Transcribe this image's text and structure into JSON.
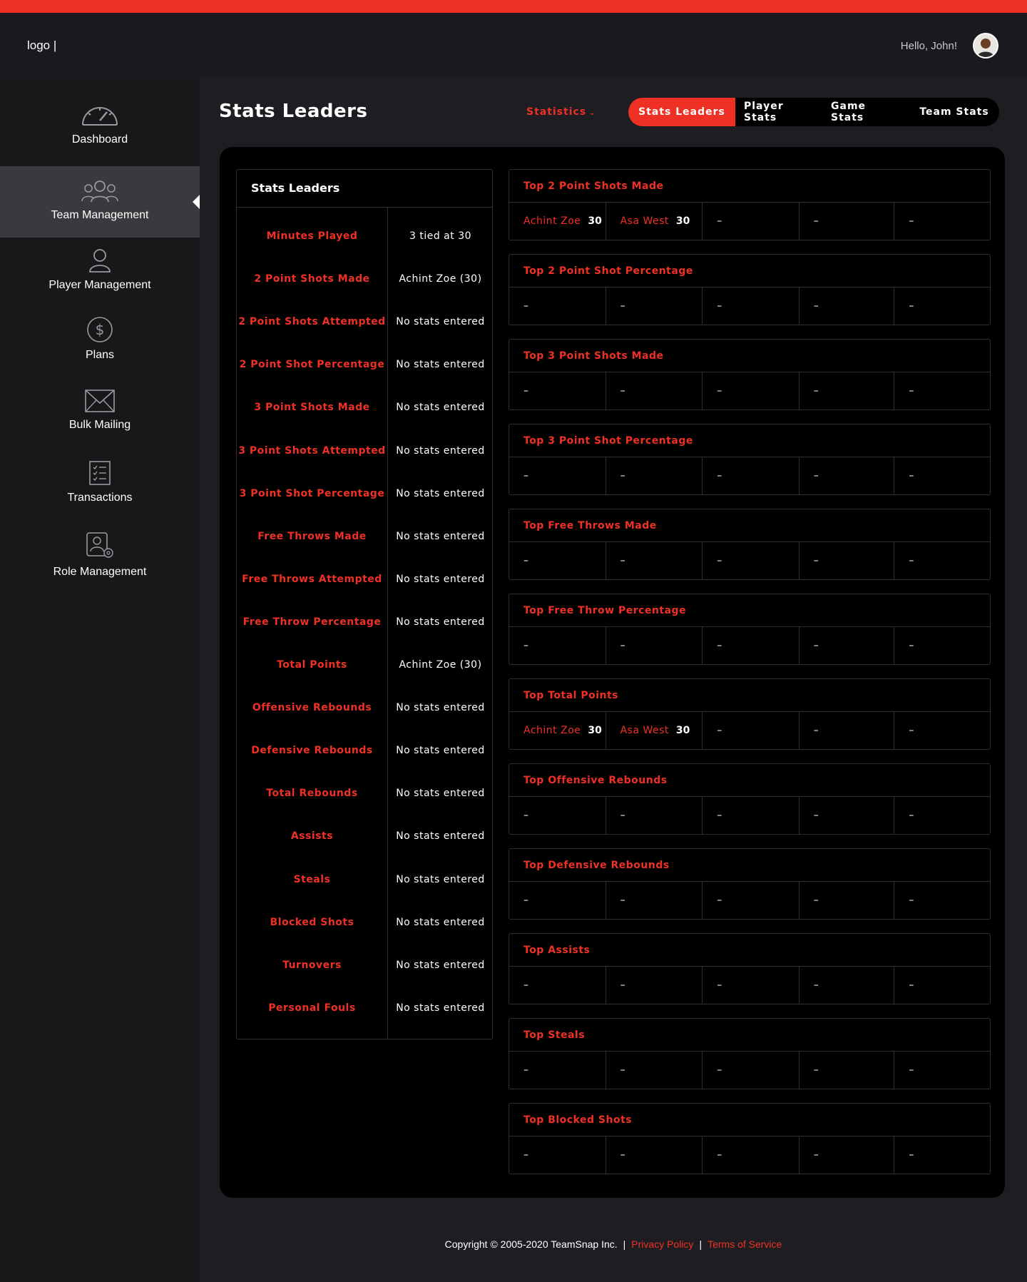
{
  "header": {
    "logo": "logo |",
    "greeting": "Hello, John!"
  },
  "colors": {
    "accent": "#ef3125",
    "panel": "#000000",
    "sidebar": "#18181b"
  },
  "sidebar": {
    "items": [
      {
        "label": "Dashboard",
        "icon": "dashboard-icon"
      },
      {
        "label": "Team Management",
        "icon": "team-icon",
        "active": true
      },
      {
        "label": "Player Management",
        "icon": "player-icon"
      },
      {
        "label": "Plans",
        "icon": "dollar-icon"
      },
      {
        "label": "Bulk Mailing",
        "icon": "envelope-icon"
      },
      {
        "label": "Transactions",
        "icon": "checklist-icon"
      },
      {
        "label": "Role Management",
        "icon": "role-settings-icon"
      }
    ]
  },
  "page": {
    "title": "Stats Leaders",
    "dropdown_label": "Statistics",
    "tabs": [
      "Stats Leaders",
      "Player Stats",
      "Game Stats",
      "Team Stats"
    ]
  },
  "leaders": {
    "title": "Stats Leaders",
    "rows": [
      {
        "name": "Minutes Played",
        "value": "3 tied at 30"
      },
      {
        "name": "2 Point Shots Made",
        "value": "Achint Zoe (30)"
      },
      {
        "name": "2 Point Shots Attempted",
        "value": "No stats entered"
      },
      {
        "name": "2 Point Shot Percentage",
        "value": "No stats entered"
      },
      {
        "name": "3 Point Shots Made",
        "value": "No stats entered"
      },
      {
        "name": "3 Point Shots Attempted",
        "value": "No stats entered"
      },
      {
        "name": "3 Point Shot Percentage",
        "value": "No stats entered"
      },
      {
        "name": "Free Throws Made",
        "value": "No stats entered"
      },
      {
        "name": "Free Throws Attempted",
        "value": "No stats entered"
      },
      {
        "name": "Free Throw Percentage",
        "value": "No stats entered"
      },
      {
        "name": "Total Points",
        "value": "Achint Zoe (30)"
      },
      {
        "name": "Offensive Rebounds",
        "value": "No stats entered"
      },
      {
        "name": "Defensive Rebounds",
        "value": "No stats entered"
      },
      {
        "name": "Total Rebounds",
        "value": "No stats entered"
      },
      {
        "name": "Assists",
        "value": "No stats entered"
      },
      {
        "name": "Steals",
        "value": "No stats entered"
      },
      {
        "name": "Blocked Shots",
        "value": "No stats entered"
      },
      {
        "name": "Turnovers",
        "value": "No stats entered"
      },
      {
        "name": "Personal Fouls",
        "value": "No stats entered"
      }
    ]
  },
  "cards": [
    {
      "title": "Top 2 Point Shots Made",
      "cells": [
        {
          "name": "Achint Zoe",
          "value": "30"
        },
        {
          "name": "Asa West",
          "value": "30"
        },
        {
          "value": "–"
        },
        {
          "value": "–"
        },
        {
          "value": "–"
        }
      ]
    },
    {
      "title": "Top 2 Point Shot Percentage",
      "cells": [
        {
          "value": "–"
        },
        {
          "value": "–"
        },
        {
          "value": "–"
        },
        {
          "value": "–"
        },
        {
          "value": "–"
        }
      ]
    },
    {
      "title": "Top 3 Point Shots Made",
      "cells": [
        {
          "value": "–"
        },
        {
          "value": "–"
        },
        {
          "value": "–"
        },
        {
          "value": "–"
        },
        {
          "value": "–"
        }
      ]
    },
    {
      "title": "Top 3 Point Shot Percentage",
      "cells": [
        {
          "value": "–"
        },
        {
          "value": "–"
        },
        {
          "value": "–"
        },
        {
          "value": "–"
        },
        {
          "value": "–"
        }
      ]
    },
    {
      "title": "Top Free Throws Made",
      "cells": [
        {
          "value": "–"
        },
        {
          "value": "–"
        },
        {
          "value": "–"
        },
        {
          "value": "–"
        },
        {
          "value": "–"
        }
      ]
    },
    {
      "title": "Top Free Throw Percentage",
      "cells": [
        {
          "value": "–"
        },
        {
          "value": "–"
        },
        {
          "value": "–"
        },
        {
          "value": "–"
        },
        {
          "value": "–"
        }
      ]
    },
    {
      "title": "Top Total Points",
      "cells": [
        {
          "name": "Achint Zoe",
          "value": "30"
        },
        {
          "name": "Asa West",
          "value": "30"
        },
        {
          "value": "–"
        },
        {
          "value": "–"
        },
        {
          "value": "–"
        }
      ]
    },
    {
      "title": "Top Offensive Rebounds",
      "cells": [
        {
          "value": "–"
        },
        {
          "value": "–"
        },
        {
          "value": "–"
        },
        {
          "value": "–"
        },
        {
          "value": "–"
        }
      ]
    },
    {
      "title": "Top Defensive Rebounds",
      "cells": [
        {
          "value": "–"
        },
        {
          "value": "–"
        },
        {
          "value": "–"
        },
        {
          "value": "–"
        },
        {
          "value": "–"
        }
      ]
    },
    {
      "title": "Top Assists",
      "cells": [
        {
          "value": "–"
        },
        {
          "value": "–"
        },
        {
          "value": "–"
        },
        {
          "value": "–"
        },
        {
          "value": "–"
        }
      ]
    },
    {
      "title": "Top Steals",
      "cells": [
        {
          "value": "–"
        },
        {
          "value": "–"
        },
        {
          "value": "–"
        },
        {
          "value": "–"
        },
        {
          "value": "–"
        }
      ]
    },
    {
      "title": "Top Blocked Shots",
      "cells": [
        {
          "value": "–"
        },
        {
          "value": "–"
        },
        {
          "value": "–"
        },
        {
          "value": "–"
        },
        {
          "value": "–"
        }
      ]
    }
  ],
  "footer": {
    "copyright": "Copyright © 2005-2020 TeamSnap Inc.",
    "privacy": "Privacy Policy",
    "terms": "Terms of Service"
  }
}
